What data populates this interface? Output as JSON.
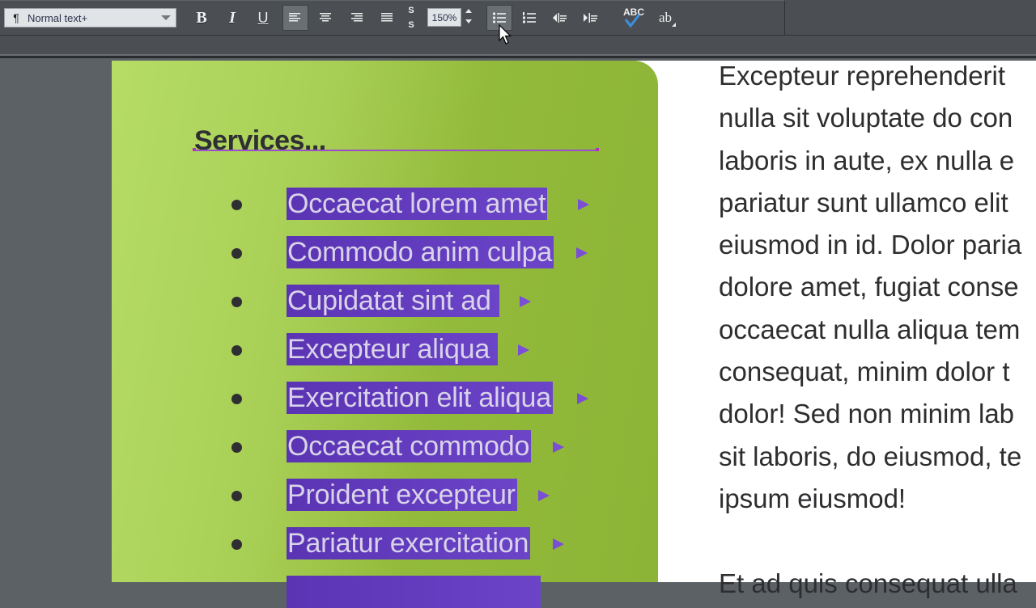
{
  "toolbar": {
    "paragraph_style": {
      "icon": "pilcrow-icon",
      "value": "Normal text+"
    },
    "bold_label": "B",
    "italic_label": "I",
    "underline_label": "U",
    "align_buttons": [
      {
        "name": "align-left",
        "icon": "align-left-icon",
        "active": true
      },
      {
        "name": "align-center",
        "icon": "align-center-icon",
        "active": false
      },
      {
        "name": "align-right",
        "icon": "align-right-icon",
        "active": false
      },
      {
        "name": "align-justify",
        "icon": "align-justify-icon",
        "active": false
      }
    ],
    "superscript_label": "S",
    "subscript_label": "S",
    "zoom_value": "150%",
    "bullets_active": true,
    "spellcheck_label": "ABC",
    "text_format_label": "ab"
  },
  "document": {
    "panel_color": "#93ba3a",
    "highlight_color": "#6240bf",
    "heading": "Services...",
    "list_items": [
      "Occaecat lorem amet",
      "Commodo anim culpa",
      "Cupidatat sint ad",
      "Excepteur aliqua",
      "Exercitation elit aliqua",
      "Occaecat commodo",
      "Proident excepteur",
      "Pariatur exercitation",
      ""
    ],
    "body_lines": [
      "Excepteur reprehenderit",
      "nulla sit voluptate do con",
      "laboris in aute, ex nulla e",
      "pariatur sunt ullamco elit",
      "eiusmod in id. Dolor paria",
      "dolore amet, fugiat conse",
      "occaecat nulla aliqua tem",
      "consequat, minim dolor t",
      "dolor! Sed non minim lab",
      "sit laboris, do eiusmod, te",
      "ipsum eiusmod!"
    ],
    "body_next_paragraph": "Et ad quis consequat ulla"
  }
}
